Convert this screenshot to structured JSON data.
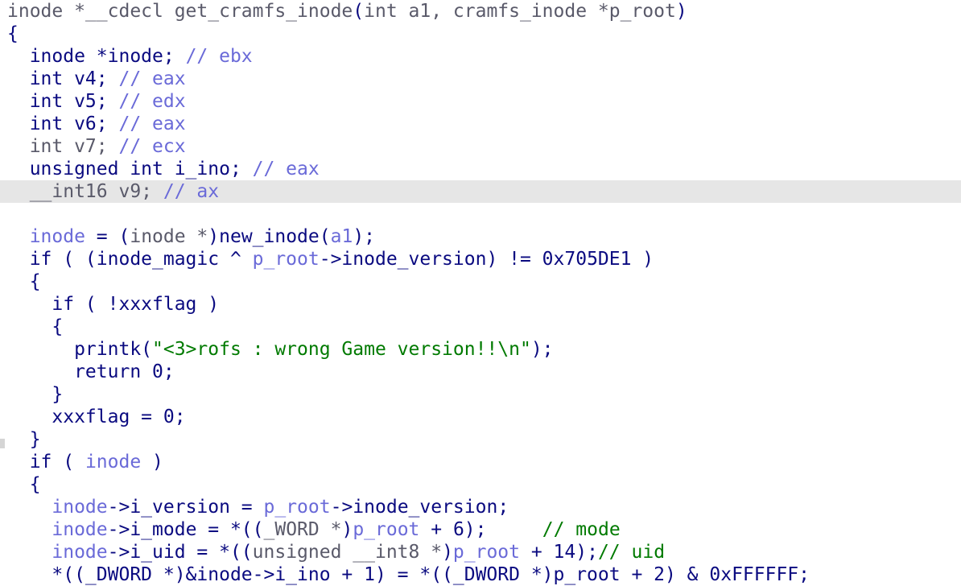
{
  "colors": {
    "background": "#ffffff",
    "highlight_line": "#e6e6e6",
    "text": "#0a0a80",
    "variable": "#6a6ad8",
    "comment": "#6a6ad8",
    "string": "#007a00",
    "signature": "#5a5a6a"
  },
  "highlighted_line_index": 8,
  "lines": [
    [
      {
        "t": "inode *__cdecl get_cramfs_inode",
        "c": "t-grey"
      },
      {
        "t": "(",
        "c": "t-plain"
      },
      {
        "t": "int a1, cramfs_inode *p_root",
        "c": "t-grey"
      },
      {
        "t": ")",
        "c": "t-plain"
      }
    ],
    [
      {
        "t": "{",
        "c": "t-plain"
      }
    ],
    [
      {
        "t": "  inode *inode; ",
        "c": "t-plain"
      },
      {
        "t": "// ebx",
        "c": "t-comment"
      }
    ],
    [
      {
        "t": "  int v4; ",
        "c": "t-plain"
      },
      {
        "t": "// eax",
        "c": "t-comment"
      }
    ],
    [
      {
        "t": "  int v5; ",
        "c": "t-plain"
      },
      {
        "t": "// edx",
        "c": "t-comment"
      }
    ],
    [
      {
        "t": "  int v6; ",
        "c": "t-plain"
      },
      {
        "t": "// eax",
        "c": "t-comment"
      }
    ],
    [
      {
        "t": "  int v7; ",
        "c": "t-grey"
      },
      {
        "t": "// ecx",
        "c": "t-comment"
      }
    ],
    [
      {
        "t": "  unsigned int i_ino; ",
        "c": "t-plain"
      },
      {
        "t": "// eax",
        "c": "t-comment"
      }
    ],
    [
      {
        "t": "  __int16 v9; ",
        "c": "t-grey"
      },
      {
        "t": "// ax",
        "c": "t-comment"
      }
    ],
    [
      {
        "t": "",
        "c": "t-plain"
      }
    ],
    [
      {
        "t": "  ",
        "c": "t-plain"
      },
      {
        "t": "inode",
        "c": "t-var"
      },
      {
        "t": " = (",
        "c": "t-plain"
      },
      {
        "t": "inode *",
        "c": "t-grey"
      },
      {
        "t": ")new_inode(",
        "c": "t-plain"
      },
      {
        "t": "a1",
        "c": "t-var"
      },
      {
        "t": ");",
        "c": "t-plain"
      }
    ],
    [
      {
        "t": "  if ( (inode_magic ^ ",
        "c": "t-plain"
      },
      {
        "t": "p_root",
        "c": "t-var"
      },
      {
        "t": "->inode_version) != 0x705DE1 )",
        "c": "t-plain"
      }
    ],
    [
      {
        "t": "  {",
        "c": "t-plain"
      }
    ],
    [
      {
        "t": "    if ( !xxxflag )",
        "c": "t-plain"
      }
    ],
    [
      {
        "t": "    {",
        "c": "t-plain"
      }
    ],
    [
      {
        "t": "      printk(",
        "c": "t-plain"
      },
      {
        "t": "\"<3>rofs : wrong Game version!!\\n\"",
        "c": "t-str"
      },
      {
        "t": ");",
        "c": "t-plain"
      }
    ],
    [
      {
        "t": "      return 0;",
        "c": "t-plain"
      }
    ],
    [
      {
        "t": "    }",
        "c": "t-plain"
      }
    ],
    [
      {
        "t": "    xxxflag = 0;",
        "c": "t-plain"
      }
    ],
    [
      {
        "t": "  }",
        "c": "t-plain"
      }
    ],
    [
      {
        "t": "  if ( ",
        "c": "t-plain"
      },
      {
        "t": "inode",
        "c": "t-var"
      },
      {
        "t": " )",
        "c": "t-plain"
      }
    ],
    [
      {
        "t": "  {",
        "c": "t-plain"
      }
    ],
    [
      {
        "t": "    ",
        "c": "t-plain"
      },
      {
        "t": "inode",
        "c": "t-var"
      },
      {
        "t": "->i_version = ",
        "c": "t-plain"
      },
      {
        "t": "p_root",
        "c": "t-var"
      },
      {
        "t": "->inode_version;",
        "c": "t-plain"
      }
    ],
    [
      {
        "t": "    ",
        "c": "t-plain"
      },
      {
        "t": "inode",
        "c": "t-var"
      },
      {
        "t": "->i_mode = *((",
        "c": "t-plain"
      },
      {
        "t": "_WORD *",
        "c": "t-grey"
      },
      {
        "t": ")",
        "c": "t-plain"
      },
      {
        "t": "p_root",
        "c": "t-var"
      },
      {
        "t": " + 6);     ",
        "c": "t-plain"
      },
      {
        "t": "// mode",
        "c": "t-green"
      }
    ],
    [
      {
        "t": "    ",
        "c": "t-plain"
      },
      {
        "t": "inode",
        "c": "t-var"
      },
      {
        "t": "->i_uid = *((",
        "c": "t-plain"
      },
      {
        "t": "unsigned __int8 *",
        "c": "t-grey"
      },
      {
        "t": ")",
        "c": "t-plain"
      },
      {
        "t": "p_root",
        "c": "t-var"
      },
      {
        "t": " + 14);",
        "c": "t-plain"
      },
      {
        "t": "// uid",
        "c": "t-green"
      }
    ],
    [
      {
        "t": "    *((_DWORD *)&inode->i_ino + 1) = *((_DWORD *)p_root + 2) & 0xFFFFFF;",
        "c": "t-plain"
      }
    ]
  ]
}
